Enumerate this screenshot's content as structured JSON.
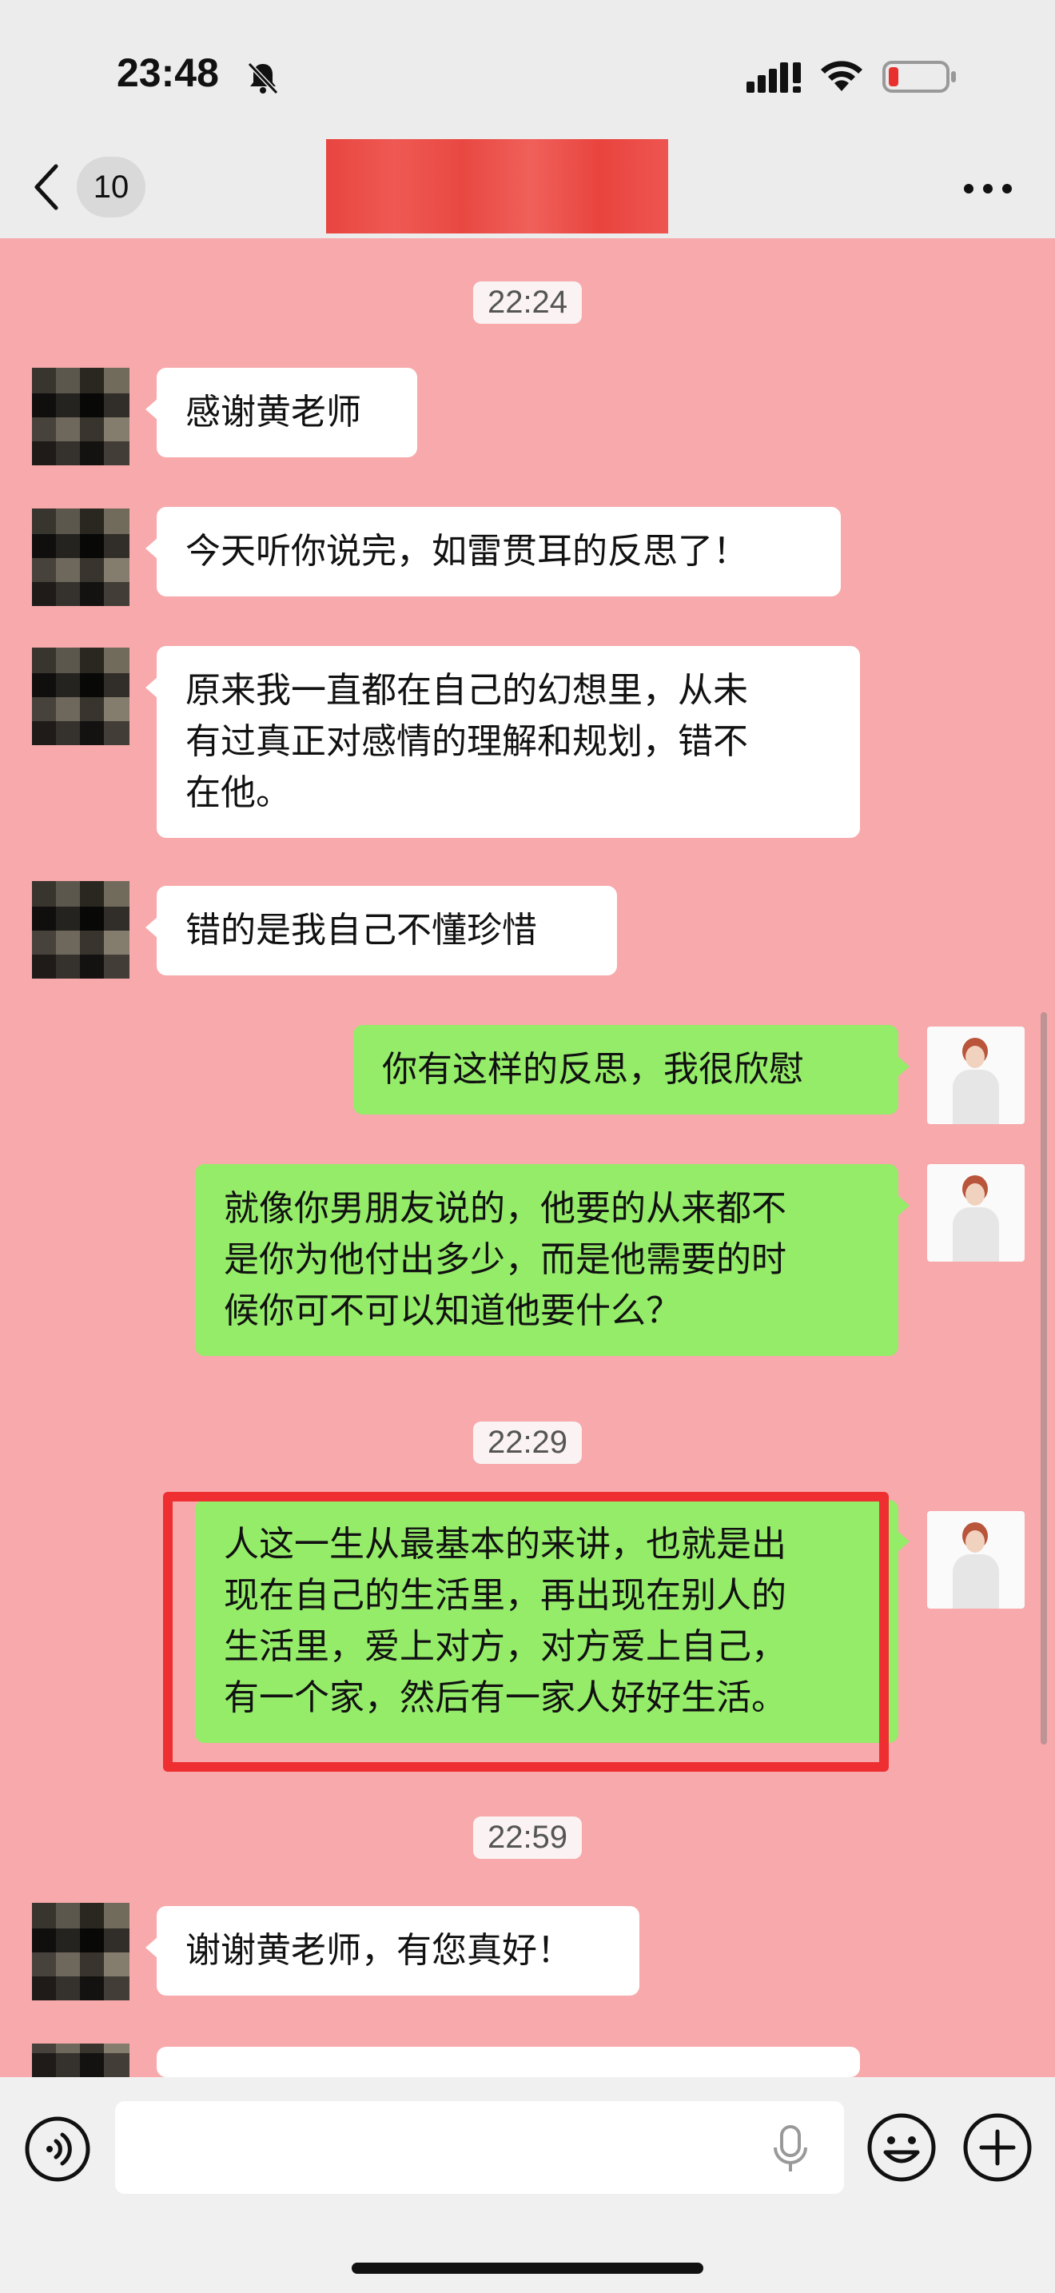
{
  "status_bar": {
    "time": "23:48",
    "icons": [
      "bell-off-icon",
      "signal-icon",
      "wifi-icon",
      "battery-low-icon"
    ]
  },
  "nav": {
    "unread_count": "10",
    "title_redacted": true,
    "icons": [
      "chevron-left-icon",
      "more-icon"
    ]
  },
  "timestamps": [
    "22:24",
    "22:29",
    "22:59"
  ],
  "messages": [
    {
      "side": "left",
      "text": "感谢黄老师"
    },
    {
      "side": "left",
      "text": "今天听你说完，如雷贯耳的反思了！"
    },
    {
      "side": "left",
      "lines": [
        "原来我一直都在自己的幻想里，从未",
        "有过真正对感情的理解和规划，错不",
        "在他。"
      ]
    },
    {
      "side": "left",
      "text": "错的是我自己不懂珍惜"
    },
    {
      "side": "right",
      "text": "你有这样的反思，我很欣慰"
    },
    {
      "side": "right",
      "lines": [
        "就像你男朋友说的，他要的从来都不",
        "是你为他付出多少，而是他需要的时",
        "候你可不可以知道他要什么？"
      ]
    },
    {
      "side": "right",
      "lines": [
        "人这一生从最基本的来讲，也就是出",
        "现在自己的生活里，再出现在别人的",
        "生活里，爱上对方，对方爱上自己，",
        "有一个家，然后有一家人好好生活。"
      ],
      "highlighted": true,
      "highlight_color": "#ee2e31"
    },
    {
      "side": "left",
      "text": "谢谢黄老师，有您真好！"
    }
  ],
  "input_bar": {
    "placeholder": "",
    "icons": [
      "voice-icon",
      "mic-icon",
      "emoji-icon",
      "add-icon"
    ]
  },
  "colors": {
    "chat_background": "#f7a9ab",
    "incoming_bubble": "#ffffff",
    "outgoing_bubble": "#95ec69",
    "highlight": "#ee2e31",
    "redaction": "#e8453f"
  }
}
